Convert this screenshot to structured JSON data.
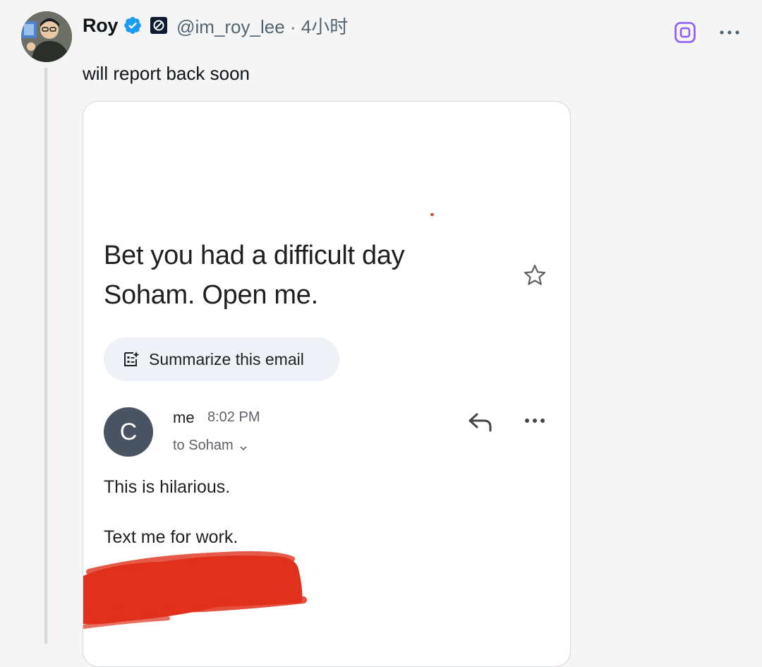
{
  "tweet": {
    "author_name": "Roy",
    "handle_meta": "@im_roy_lee · 4小时",
    "text": "will report back soon"
  },
  "icons": {
    "verified": "verified-badge-icon",
    "affiliate": "affiliate-badge-icon",
    "grok": "grok-icon",
    "more": "more-dots-icon"
  },
  "colors": {
    "verified_blue": "#1d9bf0",
    "grok_purple": "#8b5cf6",
    "redaction_red": "#e0311c",
    "sender_avatar_bg": "#485461"
  },
  "email": {
    "subject_line1": "Bet you had a difficult day",
    "subject_line2": "Soham. Open me.",
    "summarize_label": "Summarize this email",
    "sender_initial": "C",
    "sender_name": "me",
    "time": "8:02 PM",
    "recipient": "to Soham",
    "body_line1": "This is hilarious.",
    "body_line2": "Text me for work."
  }
}
